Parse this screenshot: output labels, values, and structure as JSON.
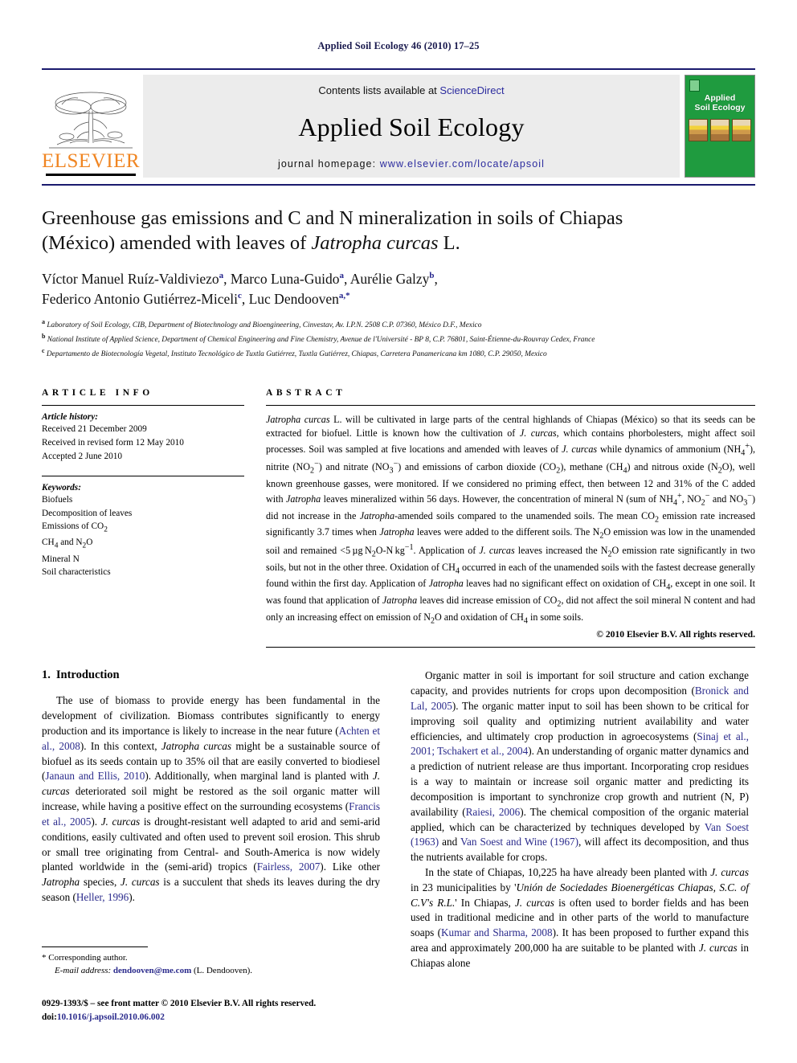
{
  "running_head": "Applied Soil Ecology 46 (2010) 17–25",
  "masthead": {
    "publisher": "ELSEVIER",
    "contents_prefix": "Contents lists available at ",
    "contents_link": "ScienceDirect",
    "journal_title": "Applied Soil Ecology",
    "homepage_prefix": "journal homepage: ",
    "homepage_url": "www.elsevier.com/locate/apsoil",
    "cover_title": "Applied\nSoil Ecology",
    "link_color": "#2b2b9e",
    "elsevier_orange": "#F08522",
    "cover_green": "#1f9b3f"
  },
  "article": {
    "title": "Greenhouse gas emissions and C and N mineralization in soils of Chiapas (México) amended with leaves of Jatropha curcas L.",
    "title_line1_pre": "Greenhouse gas emissions and C and N mineralization in soils of Chiapas",
    "title_line2_pre": "(México) amended with leaves of ",
    "title_line2_italic": "Jatropha curcas",
    "title_line2_post": " L.",
    "authors": [
      {
        "name": "Víctor Manuel Ruíz-Valdiviezo",
        "sup": "a"
      },
      {
        "name": "Marco Luna-Guido",
        "sup": "a"
      },
      {
        "name": "Aurélie Galzy",
        "sup": "b"
      },
      {
        "name": "Federico Antonio Gutiérrez-Miceli",
        "sup": "c"
      },
      {
        "name": "Luc Dendooven",
        "sup": "a,*"
      }
    ],
    "affiliations": [
      {
        "mark": "a",
        "text": "Laboratory of Soil Ecology, CIB, Department of Biotechnology and Bioengineering, Cinvestav, Av. I.P.N. 2508 C.P. 07360, México D.F., Mexico"
      },
      {
        "mark": "b",
        "text": "National Institute of Applied Science, Department of Chemical Engineering and Fine Chemistry, Avenue de l'Université - BP 8, C.P. 76801, Saint-Étienne-du-Rouvray Cedex, France"
      },
      {
        "mark": "c",
        "text": "Departamento de Biotecnología Vegetal, Instituto Tecnológico de Tuxtla Gutiérrez, Tuxtla Gutiérrez, Chiapas, Carretera Panamericana km 1080, C.P. 29050, Mexico"
      }
    ]
  },
  "article_info": {
    "heading": "ARTICLE INFO",
    "history_label": "Article history:",
    "history": [
      "Received 21 December 2009",
      "Received in revised form 12 May 2010",
      "Accepted 2 June 2010"
    ],
    "keywords_label": "Keywords:",
    "keywords": [
      "Biofuels",
      "Decomposition of leaves",
      "Emissions of CO2",
      "CH4 and N2O",
      "Mineral N",
      "Soil characteristics"
    ]
  },
  "abstract": {
    "heading": "ABSTRACT",
    "copyright": "© 2010 Elsevier B.V. All rights reserved."
  },
  "introduction": {
    "heading_number": "1.",
    "heading_text": "Introduction"
  },
  "footnotes": {
    "corresponding": "* Corresponding author.",
    "email_label": "E-mail address:",
    "email": "dendooven@me.com",
    "email_who": " (L. Dendooven).",
    "issn_line": "0929-1393/$ – see front matter © 2010 Elsevier B.V. All rights reserved.",
    "doi_label": "doi:",
    "doi_value": "10.1016/j.apsoil.2010.06.002"
  }
}
